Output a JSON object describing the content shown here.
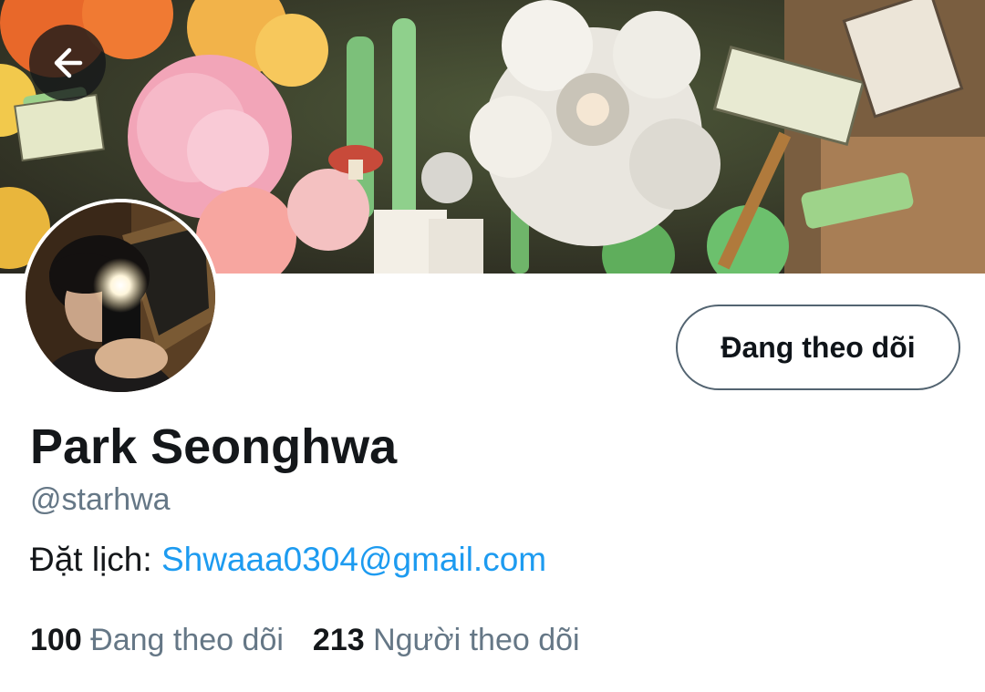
{
  "header": {
    "back_icon": "arrow-left-icon"
  },
  "profile": {
    "display_name": "Park Seonghwa",
    "handle": "@starhwa",
    "bio_prefix": "Đặt lịch: ",
    "bio_link": "Shwaaa0304@gmail.com",
    "follow_button_label": "Đang theo dõi"
  },
  "stats": {
    "following_count": "100",
    "following_label": " Đang theo dõi",
    "followers_count": "213",
    "followers_label": " Người theo dõi"
  },
  "colors": {
    "link": "#1d9bf0",
    "secondary_text": "#657786",
    "primary_text": "#14171a"
  }
}
